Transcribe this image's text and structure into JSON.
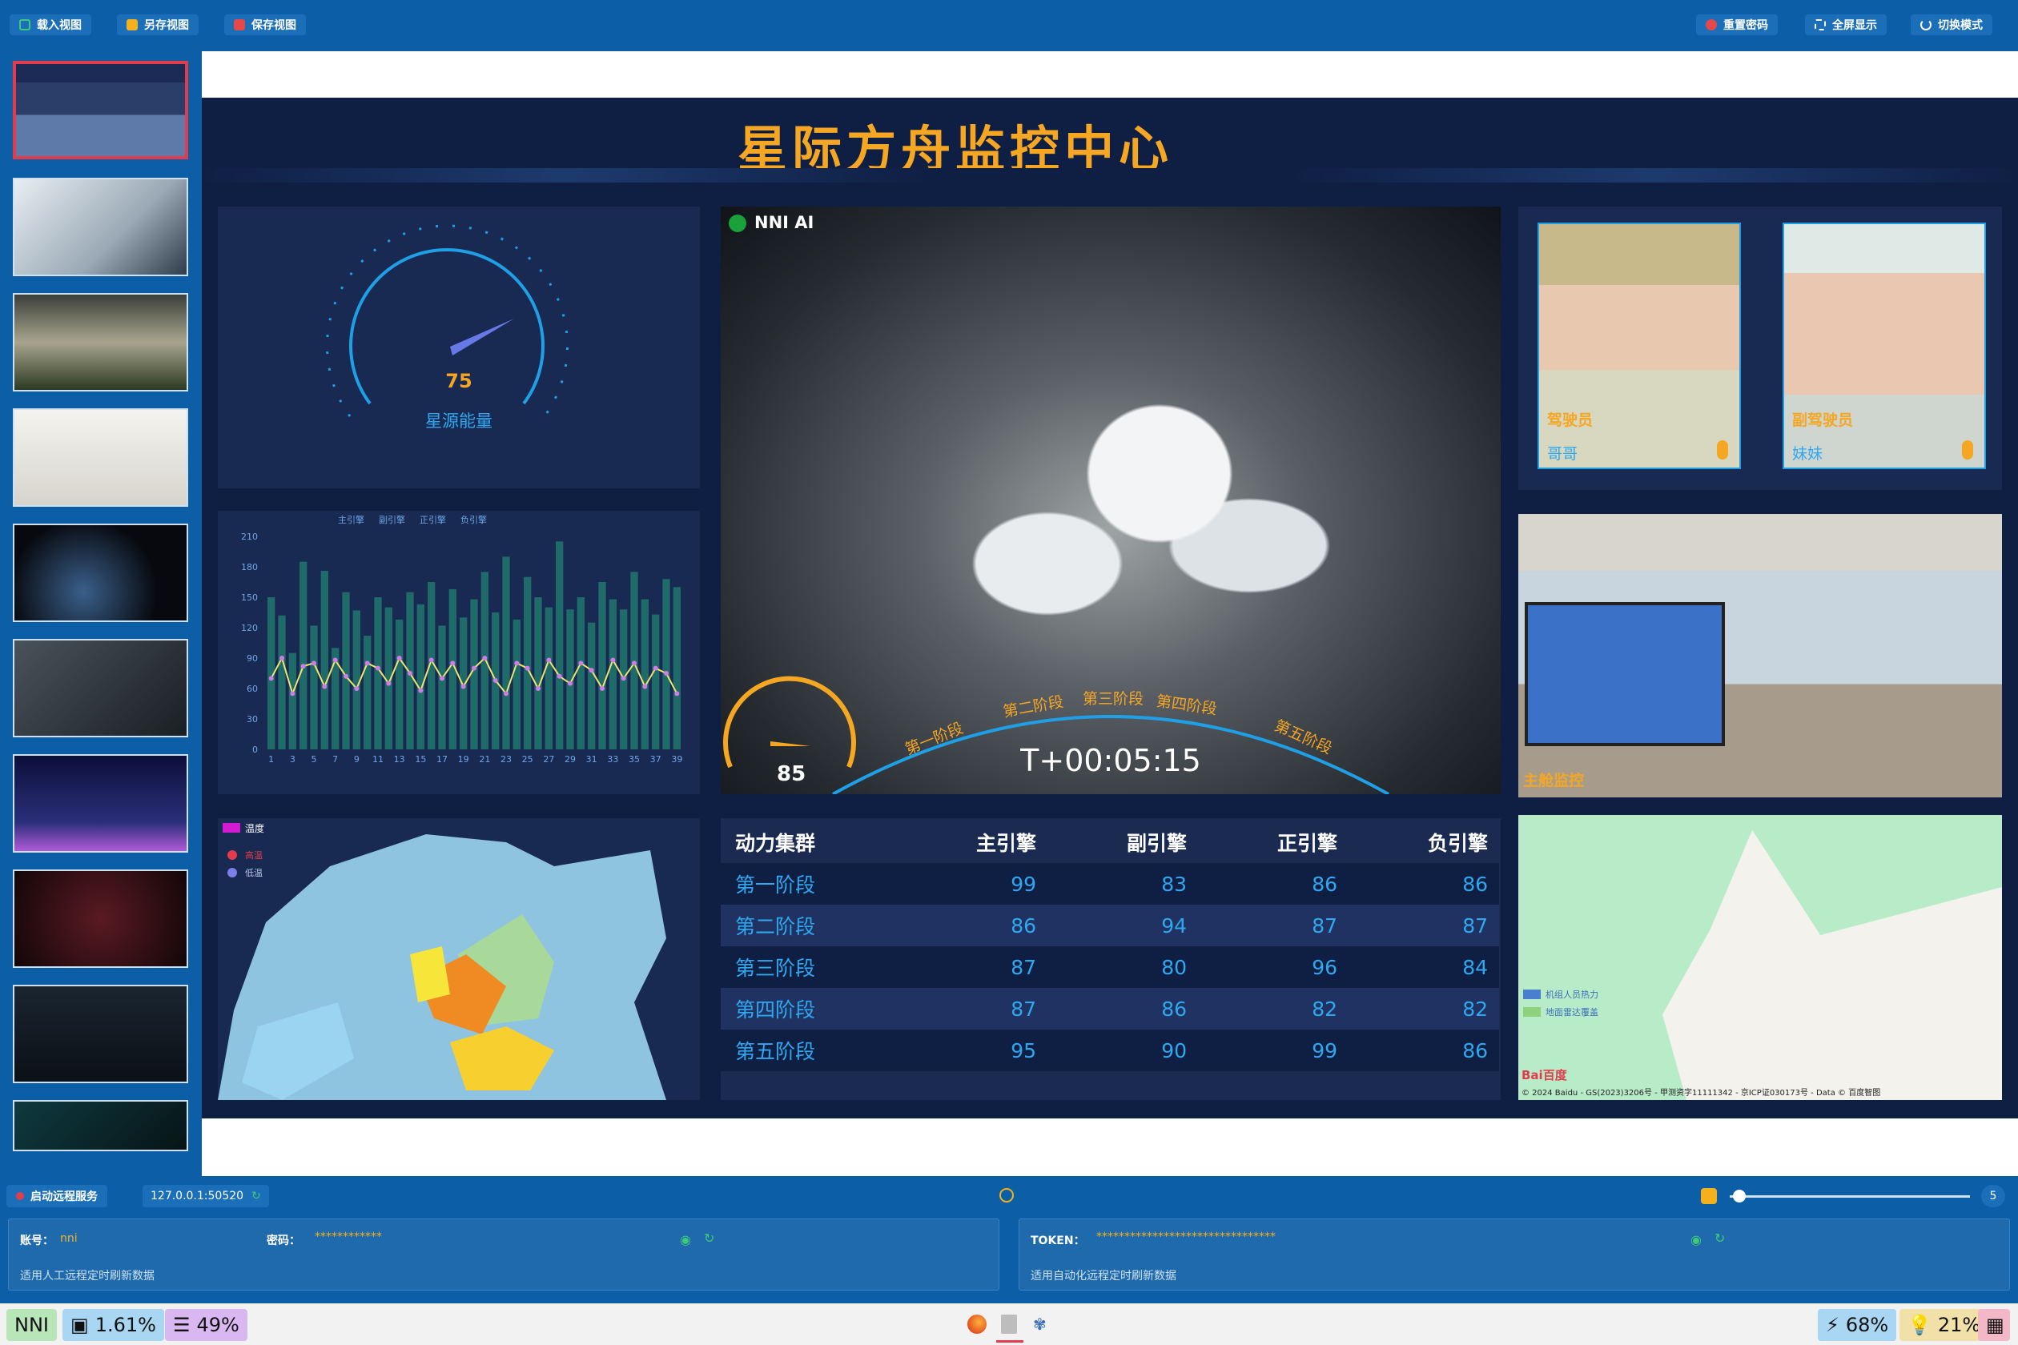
{
  "toolbar": {
    "load": "载入视图",
    "saveas": "另存视图",
    "save": "保存视图",
    "reset": "重置密码",
    "fullscreen": "全屏显示",
    "switch": "切换模式"
  },
  "thumbs": [
    "thumb-dashboard",
    "thumb-hands-camera",
    "thumb-miniature-city",
    "thumb-photo-wall",
    "thumb-keyboard-glow",
    "thumb-dark-hand",
    "thumb-night-city",
    "thumb-red-keyboard",
    "thumb-laptop-code",
    "thumb-teal-device"
  ],
  "dash": {
    "title": "星际方舟监控中心",
    "gauge": {
      "value": "75",
      "label": "星源能量"
    },
    "chart_legend": [
      "主引擎",
      "副引擎",
      "正引擎",
      "负引擎"
    ],
    "video": {
      "label": "NNI AI",
      "timer": "T+00:05:15",
      "speed": "85",
      "stages": [
        "第一阶段",
        "第二阶段",
        "第三阶段",
        "第四阶段",
        "第五阶段"
      ]
    },
    "pilot": {
      "role": "驾驶员",
      "name": "哥哥"
    },
    "copilot": {
      "role": "副驾驶员",
      "name": "妹妹"
    },
    "cam": {
      "label": "主舱监控"
    },
    "map_legend": {
      "title": "温度",
      "a": "高温",
      "b": "低温"
    },
    "table": {
      "headers": [
        "动力集群",
        "主引擎",
        "副引擎",
        "正引擎",
        "负引擎"
      ],
      "rows": [
        [
          "第一阶段",
          "99",
          "83",
          "86",
          "86"
        ],
        [
          "第二阶段",
          "86",
          "94",
          "87",
          "87"
        ],
        [
          "第三阶段",
          "87",
          "80",
          "96",
          "84"
        ],
        [
          "第四阶段",
          "87",
          "86",
          "82",
          "82"
        ],
        [
          "第五阶段",
          "95",
          "90",
          "99",
          "86"
        ]
      ]
    },
    "bmap": {
      "legend_a": "机组人员热力",
      "legend_b": "地面雷达覆盖",
      "copyright": "© 2024 Baidu - GS(2023)3206号 - 甲测资字11111342 - 京ICP证030173号 - Data © 百度智图",
      "logo": "Bai百度"
    }
  },
  "remote": {
    "start": "启动远程服务",
    "addr": "127.0.0.1:50520",
    "slider_value": "5",
    "account_label": "账号：",
    "account": "nni",
    "password_label": "密码：",
    "password": "************",
    "hint1": "适用人工远程定时刷新数据",
    "token_label": "TOKEN：",
    "token": "********************************",
    "hint2": "适用自动化远程定时刷新数据"
  },
  "taskbar": {
    "brand": "NNI",
    "cpu": "1.61%",
    "mem": "49%",
    "battery": "68%",
    "bright": "21%"
  },
  "chart_data": {
    "type": "bar",
    "categories": [
      "1",
      "2",
      "3",
      "4",
      "5",
      "6",
      "7",
      "8",
      "9",
      "10",
      "11",
      "12",
      "13",
      "14",
      "15",
      "16",
      "17",
      "18",
      "19",
      "20",
      "21",
      "22",
      "23",
      "24",
      "25",
      "26",
      "27",
      "28",
      "29",
      "30",
      "31",
      "32",
      "33",
      "34",
      "35",
      "36",
      "37",
      "38",
      "39"
    ],
    "ylim": [
      0,
      210
    ],
    "yticks": [
      0,
      30,
      60,
      90,
      120,
      150,
      180,
      210
    ],
    "series": [
      {
        "name": "负引擎",
        "values": [
          150,
          132,
          95,
          185,
          122,
          176,
          100,
          155,
          137,
          112,
          150,
          140,
          128,
          155,
          143,
          165,
          122,
          158,
          130,
          148,
          175,
          135,
          190,
          128,
          170,
          150,
          140,
          205,
          138,
          150,
          125,
          165,
          148,
          138,
          175,
          148,
          133,
          168,
          160
        ]
      },
      {
        "name": "主引擎",
        "values": [
          70,
          90,
          55,
          82,
          85,
          62,
          88,
          72,
          60,
          85,
          80,
          65,
          90,
          75,
          58,
          88,
          70,
          85,
          62,
          80,
          90,
          68,
          55,
          85,
          80,
          60,
          88,
          72,
          65,
          85,
          78,
          60,
          88,
          70,
          85,
          62,
          80,
          75,
          55
        ]
      }
    ]
  }
}
